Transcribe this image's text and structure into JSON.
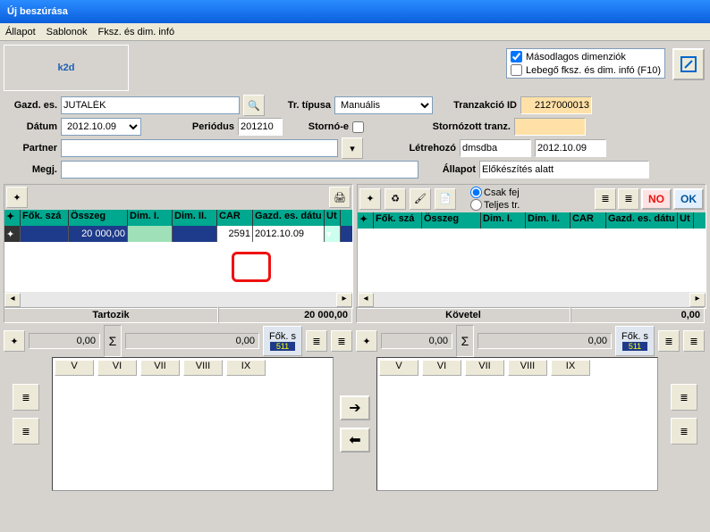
{
  "window_title": "Új beszúrása",
  "menu": {
    "m1": "Állapot",
    "m2": "Sablonok",
    "m3": "Fksz. és dim. infó"
  },
  "logo": "k2d",
  "topcheck": {
    "c1": "Másodlagos dimenziók",
    "c2": "Lebegő fksz. és dim. infó  (F10)"
  },
  "hdr": {
    "gazd_lbl": "Gazd. es.",
    "gazd_val": "JUTALÉK",
    "datum_lbl": "Dátum",
    "datum_val": "2012.10.09",
    "periodus_lbl": "Periódus",
    "periodus_val": "201210",
    "tr_lbl": "Tr. típusa",
    "tr_val": "Manuális",
    "tranz_lbl": "Tranzakció ID",
    "tranz_val": "2127000013",
    "storno_lbl": "Stornó-e",
    "stornoz_lbl": "Stornózott tranz.",
    "stornoz_val": "",
    "partner_lbl": "Partner",
    "partner_val": "",
    "letre_lbl": "Létrehozó",
    "letre_val": "dmsdba",
    "letre_date": "2012.10.09",
    "megj_lbl": "Megj.",
    "megj_val": "",
    "allapot_lbl": "Állapot",
    "allapot_val": "Előkészítés alatt"
  },
  "cols": {
    "c1": "Fők. szá",
    "c2": "Összeg",
    "c3": "Dim. I.",
    "c4": "Dim. II.",
    "c5": "CAR",
    "c6": "Gazd. es. dátu",
    "c7": "Ut"
  },
  "row1": {
    "osszeg": "20 000,00",
    "car": "2591",
    "datum": "2012.10.09"
  },
  "radio": {
    "r1": "Csak fej",
    "r2": "Teljes tr."
  },
  "sum": {
    "tartozik_lbl": "Tartozik",
    "tartozik_val": "20 000,00",
    "kovetel_lbl": "Követel",
    "kovetel_val": "0,00",
    "zero": "0,00",
    "foks": "Fők. s",
    "foks_n": "511"
  },
  "tabs": {
    "t1": "V",
    "t2": "VI",
    "t3": "VII",
    "t4": "VIII",
    "t5": "IX"
  },
  "btns": {
    "no": "NO",
    "ok": "OK",
    "plus": "✦"
  }
}
